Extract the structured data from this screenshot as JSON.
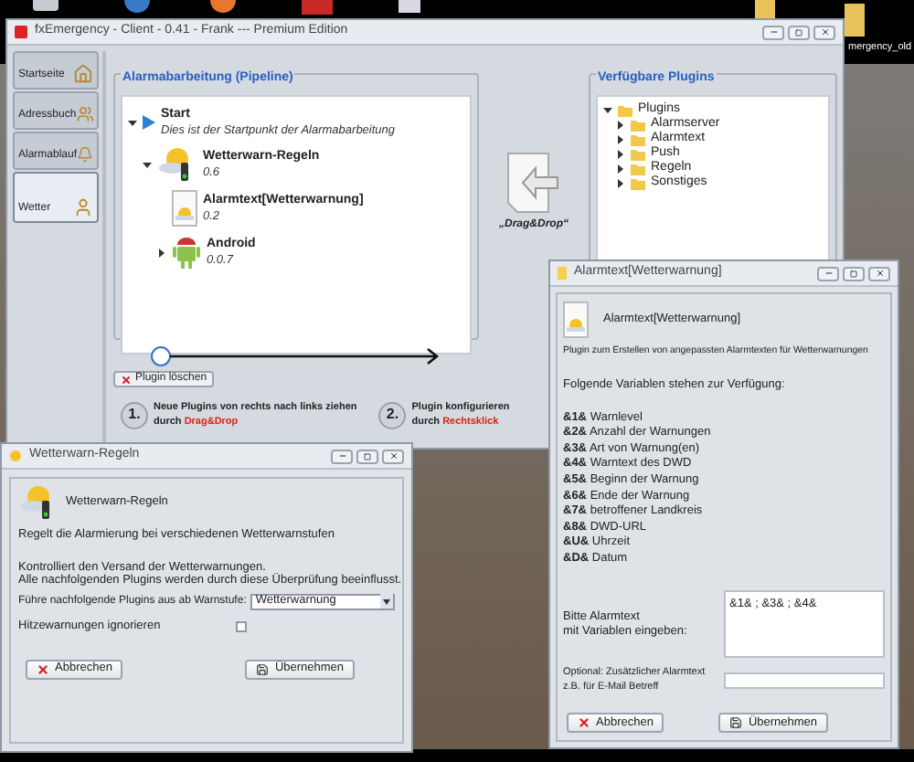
{
  "desktop": {
    "icon_label": "mergency_old"
  },
  "main_window": {
    "title": "fxEmergency - Client - 0.41 - Frank --- Premium Edition",
    "tabs": [
      {
        "label": "Startseite",
        "kind": "home",
        "selected": false
      },
      {
        "label": "Adressbuch",
        "kind": "people",
        "selected": false
      },
      {
        "label": "Alarmablauf",
        "kind": "bell",
        "selected": false
      },
      {
        "label": "Wetter",
        "kind": "person",
        "selected": true
      }
    ],
    "pipeline": {
      "title": "Alarmabarbeitung (Pipeline)",
      "tree": [
        {
          "kind": "start",
          "label": "Start",
          "subtitle": "Dies ist der Startpunkt der Alarmabarbeitung",
          "expanded": true,
          "children": [
            {
              "kind": "rules",
              "label": "Wetterwarn-Regeln",
              "version": "0.6",
              "expanded": true,
              "children": [
                {
                  "kind": "alarmtext",
                  "label": "Alarmtext[Wetterwarnung]",
                  "version": "0.2"
                },
                {
                  "kind": "android",
                  "label": "Android",
                  "version": "0.0.7",
                  "expanded": false
                }
              ]
            }
          ]
        }
      ]
    },
    "delete_button": "Plugin löschen",
    "steps": [
      {
        "number": "1.",
        "line1": "Neue Plugins von rechts nach links ziehen",
        "line2": "durch",
        "highlight": "Drag&Drop"
      },
      {
        "number": "2.",
        "line1": "Plugin konfigurieren",
        "line2": "durch",
        "highlight": "Rechtsklick"
      }
    ],
    "drag_label": "„Drag&Drop“",
    "plugins": {
      "title": "Verfügbare Plugins",
      "tree": [
        {
          "label": "Plugins",
          "expanded": true,
          "children": [
            {
              "label": "Alarmserver",
              "expanded": false
            },
            {
              "label": "Alarmtext",
              "expanded": false
            },
            {
              "label": "Push",
              "expanded": false
            },
            {
              "label": "Regeln",
              "expanded": false
            },
            {
              "label": "Sonstiges",
              "expanded": false
            }
          ]
        }
      ]
    }
  },
  "alarmtext_window": {
    "title": "Alarmtext[Wetterwarnung]",
    "heading": "Alarmtext[Wetterwarnung]",
    "description": "Plugin zum Erstellen von angepassten Alarmtexten für Wetterwarnungen",
    "intro": "Folgende Variablen stehen zur Verfügung:",
    "variables": [
      {
        "code": "&1&",
        "meaning": "Warnlevel"
      },
      {
        "code": "&2&",
        "meaning": "Anzahl der Warnungen"
      },
      {
        "code": "&3&",
        "meaning": "Art von Warnung(en)"
      },
      {
        "code": "&4&",
        "meaning": "Warntext des DWD"
      },
      {
        "code": "&5&",
        "meaning": "Beginn der Warnung"
      },
      {
        "code": "&6&",
        "meaning": "Ende der Warnung"
      },
      {
        "code": "&7&",
        "meaning": "betroffener Landkreis"
      },
      {
        "code": "&8&",
        "meaning": "DWD-URL"
      },
      {
        "code": "&U&",
        "meaning": "Uhrzeit"
      },
      {
        "code": "&D&",
        "meaning": "Datum"
      }
    ],
    "text_label": [
      "Bitte Alarmtext",
      "mit Variablen eingeben:"
    ],
    "text_value": "&1& ; &3& ; &4&",
    "optional_label": [
      "Optional: Zusätzlicher Alarmtext",
      "z.B. für E-Mail Betreff"
    ],
    "cancel": "Abbrechen",
    "apply": "Übernehmen"
  },
  "wetterwarn_window": {
    "title": "Wetterwarn-Regeln",
    "heading": "Wetterwarn-Regeln",
    "description": "Regelt die Alarmierung bei verschiedenen Wetterwarnstufen",
    "info": [
      "Kontrolliert den Versand der Wetterwarnungen.",
      "Alle nachfolgenden Plugins werden durch diese Überprüfung beeinflusst."
    ],
    "level_label": "Führe nachfolgende Plugins aus ab Warnstufe:",
    "level_value": "Wetterwarnung",
    "ignore_label": "Hitzewarnungen ignorieren",
    "ignore_checked": false,
    "cancel": "Abbrechen",
    "apply": "Übernehmen"
  }
}
